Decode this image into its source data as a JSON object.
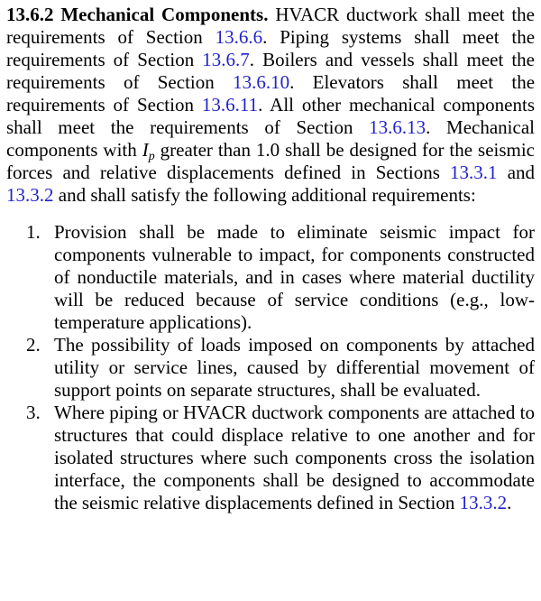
{
  "section": {
    "heading": "13.6.2 Mechanical Components.",
    "intro": {
      "t1": "HVACR ductwork shall meet the requirements of Section",
      "ref1": "13.6.6",
      "t2": ". Piping systems shall meet the requirements of Section",
      "ref2": "13.6.7",
      "t3": ". Boilers and vessels shall meet the requirements of Section",
      "ref3": "13.6.10",
      "t4": ". Elevators shall meet the requirements of Section",
      "ref4": "13.6.11",
      "t5": ". All other mechanical components shall meet the requirements of Section",
      "ref5": "13.6.13",
      "t6": ". Mechanical components with",
      "ip_base": "I",
      "ip_sub": "p",
      "t7": "greater than 1.0 shall be designed for the seismic forces and relative displacements defined in Sections",
      "ref6": "13.3.1",
      "t8": "and",
      "ref7": "13.3.2",
      "t9": "and shall satisfy the following additional requirements:"
    },
    "requirements": [
      {
        "number": "1.",
        "text": "Provision shall be made to eliminate seismic impact for components vulnerable to impact, for components con­structed of nonductile materials, and in cases where mate­rial ductility will be reduced because of service conditions (e.g., low-temperature applications)."
      },
      {
        "number": "2.",
        "text": "The possibility of loads imposed on components by attached utility or service lines, caused by differential movement of support points on separate structures, shall be evaluated."
      },
      {
        "number": "3.",
        "text": "Where piping or HVACR ductwork components are at­tached to structures that could displace relative to one another and for isolated structures where such components cross the isolation interface, the components shall be designed to accommodate the seismic relative displace­ments defined in Section",
        "ref": "13.3.2",
        "tail": "."
      }
    ]
  },
  "colors": {
    "link": "#2222cc",
    "text": "#000000"
  }
}
